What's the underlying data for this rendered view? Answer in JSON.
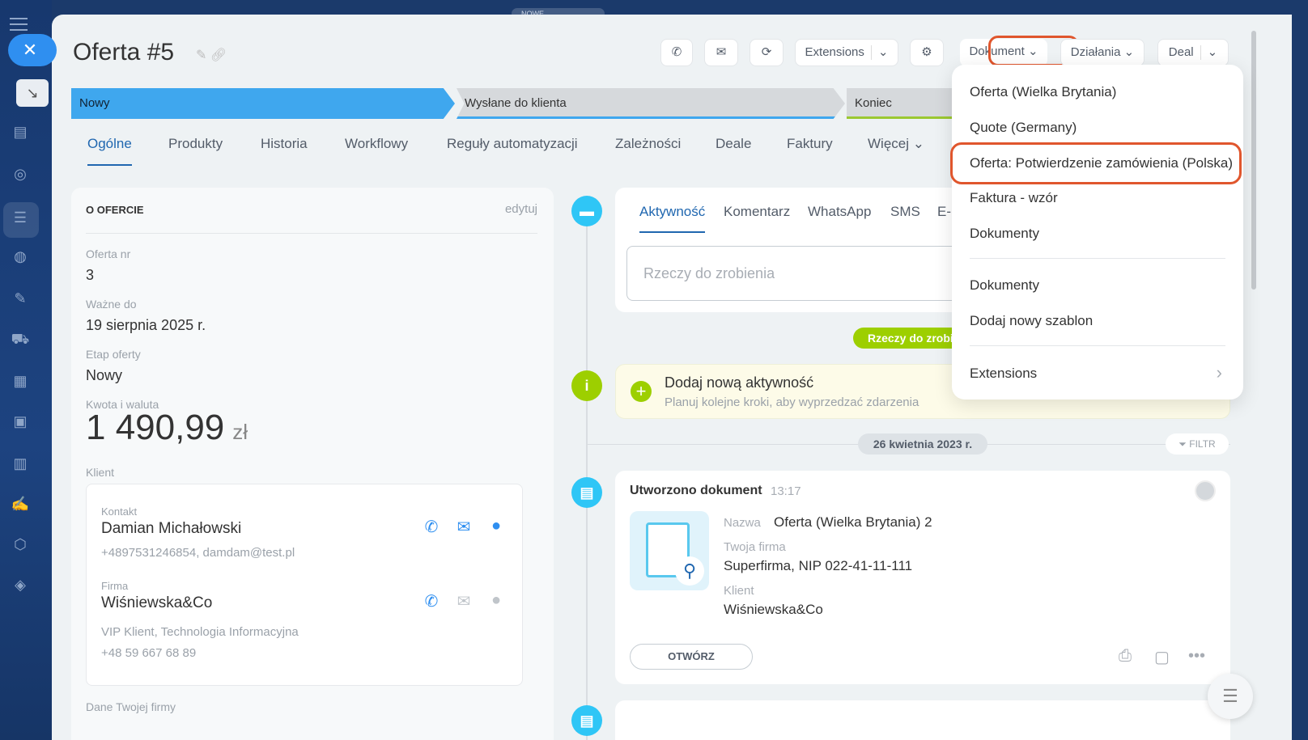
{
  "window": {
    "badge": "NOWE"
  },
  "header": {
    "title": "Oferta #5",
    "buttons": {
      "extensions": "Extensions",
      "dokument": "Dokument",
      "dzialania": "Działania",
      "deal": "Deal"
    }
  },
  "stages": [
    "Nowy",
    "Wysłane do klienta",
    "Koniec"
  ],
  "tabs": [
    "Ogólne",
    "Produkty",
    "Historia",
    "Workflowy",
    "Reguły automatyzacji",
    "Zależności",
    "Deale",
    "Faktury",
    "Więcej"
  ],
  "about": {
    "heading": "O OFERCIE",
    "edit": "edytuj",
    "fields": [
      {
        "label": "Oferta nr",
        "value": "3"
      },
      {
        "label": "Ważne do",
        "value": "19 sierpnia 2025 r."
      },
      {
        "label": "Etap oferty",
        "value": "Nowy"
      }
    ],
    "amount_label": "Kwota i waluta",
    "amount": "1 490,99",
    "currency": "zł",
    "client_label": "Klient",
    "contact": {
      "label": "Kontakt",
      "name": "Damian Michałowski",
      "sub": "+4897531246854, damdam@test.pl"
    },
    "company": {
      "label": "Firma",
      "name": "Wiśniewska&Co",
      "sub": "VIP Klient, Technologia Informacyjna",
      "phone": "+48 59 667 68 89"
    },
    "bottom_label": "Dane Twojej firmy"
  },
  "activity": {
    "tabs": [
      "Aktywność",
      "Komentarz",
      "WhatsApp",
      "SMS",
      "E-"
    ],
    "placeholder": "Rzeczy do zrobienia",
    "todo_pill": "Rzeczy do zrobi",
    "add_title": "Dodaj nową aktywność",
    "add_sub": "Planuj kolejne kroki, aby wyprzedzać zdarzenia",
    "date": "26 kwietnia 2023 r.",
    "filter": "FILTR"
  },
  "doc": {
    "title": "Utworzono dokument",
    "time": "13:17",
    "name_label": "Nazwa",
    "name": "Oferta (Wielka Brytania) 2",
    "firm_label": "Twoja firma",
    "firm": "Superfirma, NIP 022-41-11-111",
    "client_label": "Klient",
    "client": "Wiśniewska&Co",
    "open": "OTWÓRZ"
  },
  "dropdown": {
    "items": [
      "Oferta (Wielka Brytania)",
      "Quote (Germany)",
      "Oferta: Potwierdzenie zamówienia (Polska)",
      "Faktura - wzór",
      "Dokumenty"
    ],
    "items2": [
      "Dokumenty",
      "Dodaj nowy szablon"
    ],
    "extensions": "Extensions"
  },
  "colors": {
    "accent": "#2067b0",
    "stage_active": "#3fa7ee",
    "highlight": "#e0562d",
    "green": "#9dcf00"
  }
}
